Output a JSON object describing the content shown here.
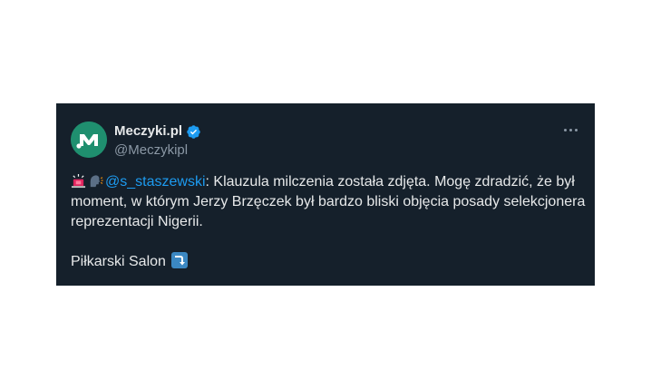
{
  "tweet": {
    "display_name": "Meczyki.pl",
    "handle": "@Meczykipl",
    "mention": "@s_staszewski",
    "body_line_after_mention": ": Klauzula milczenia została zdjęta. Mogę zdradzić, że był moment, w którym Jerzy Brzęczek był bardzo bliski objęcia posady selekcjonera reprezentacji Nigerii.",
    "signature": "Piłkarski Salon"
  },
  "icons": {
    "avatar": "meczyki-logo",
    "verified": "verified-badge-icon",
    "more": "more-options-icon",
    "emoji_1": "police-light-emoji",
    "emoji_2": "speaking-head-emoji",
    "emoji_3": "right-arrow-curving-down-emoji"
  },
  "colors": {
    "card_background": "#15202b",
    "text_primary": "#e7e9ea",
    "text_secondary": "#8b98a5",
    "link": "#1d9bf0",
    "verified": "#1d9bf0",
    "avatar_bg": "#1f8f6f"
  }
}
